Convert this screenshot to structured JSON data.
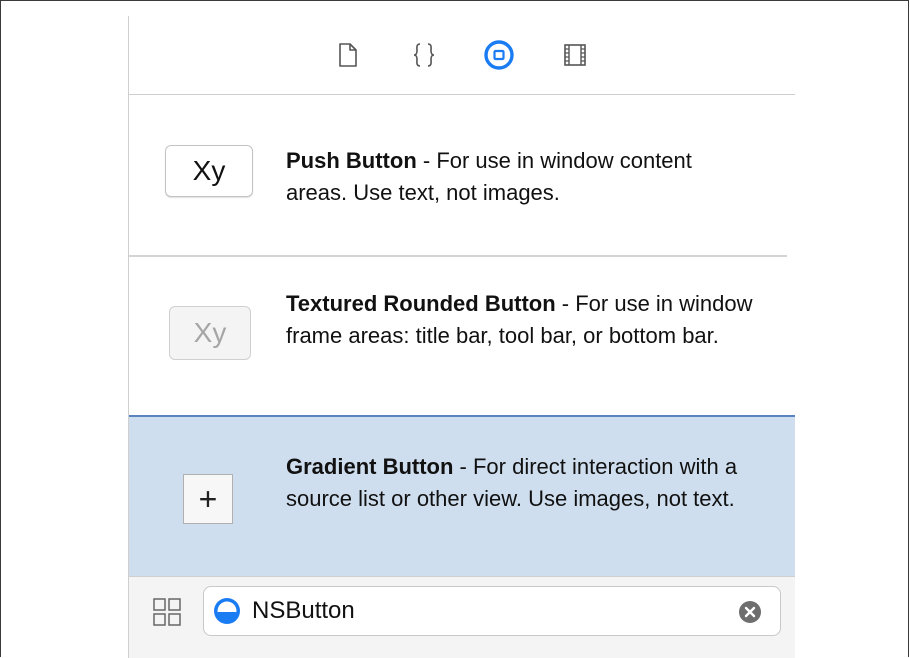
{
  "toolbar": {
    "tabs": [
      {
        "icon": "file-icon",
        "active": false
      },
      {
        "icon": "braces-icon",
        "active": false
      },
      {
        "icon": "object-library-icon",
        "active": true
      },
      {
        "icon": "media-library-icon",
        "active": false
      }
    ],
    "accent_color": "#1a7cf2"
  },
  "items": [
    {
      "preview_label": "Xy",
      "name": "Push Button",
      "description": " - For use in window content areas. Use text, not images.",
      "selected": false
    },
    {
      "preview_label": "Xy",
      "name": "Textured Rounded Button",
      "description": " - For use in window frame areas: title bar, tool bar, or bottom bar.",
      "selected": false
    },
    {
      "preview_label": "+",
      "name": "Gradient Button",
      "description": " - For direct interaction with a source list or other view. Use images, not text.",
      "selected": true
    }
  ],
  "selection_color": "#cfdeee",
  "bottom_bar": {
    "grid_icon": "grid-view-icon",
    "filter": {
      "value": "NSButton",
      "filter_icon": "object-filter-icon",
      "clear_icon": "clear-icon"
    }
  }
}
